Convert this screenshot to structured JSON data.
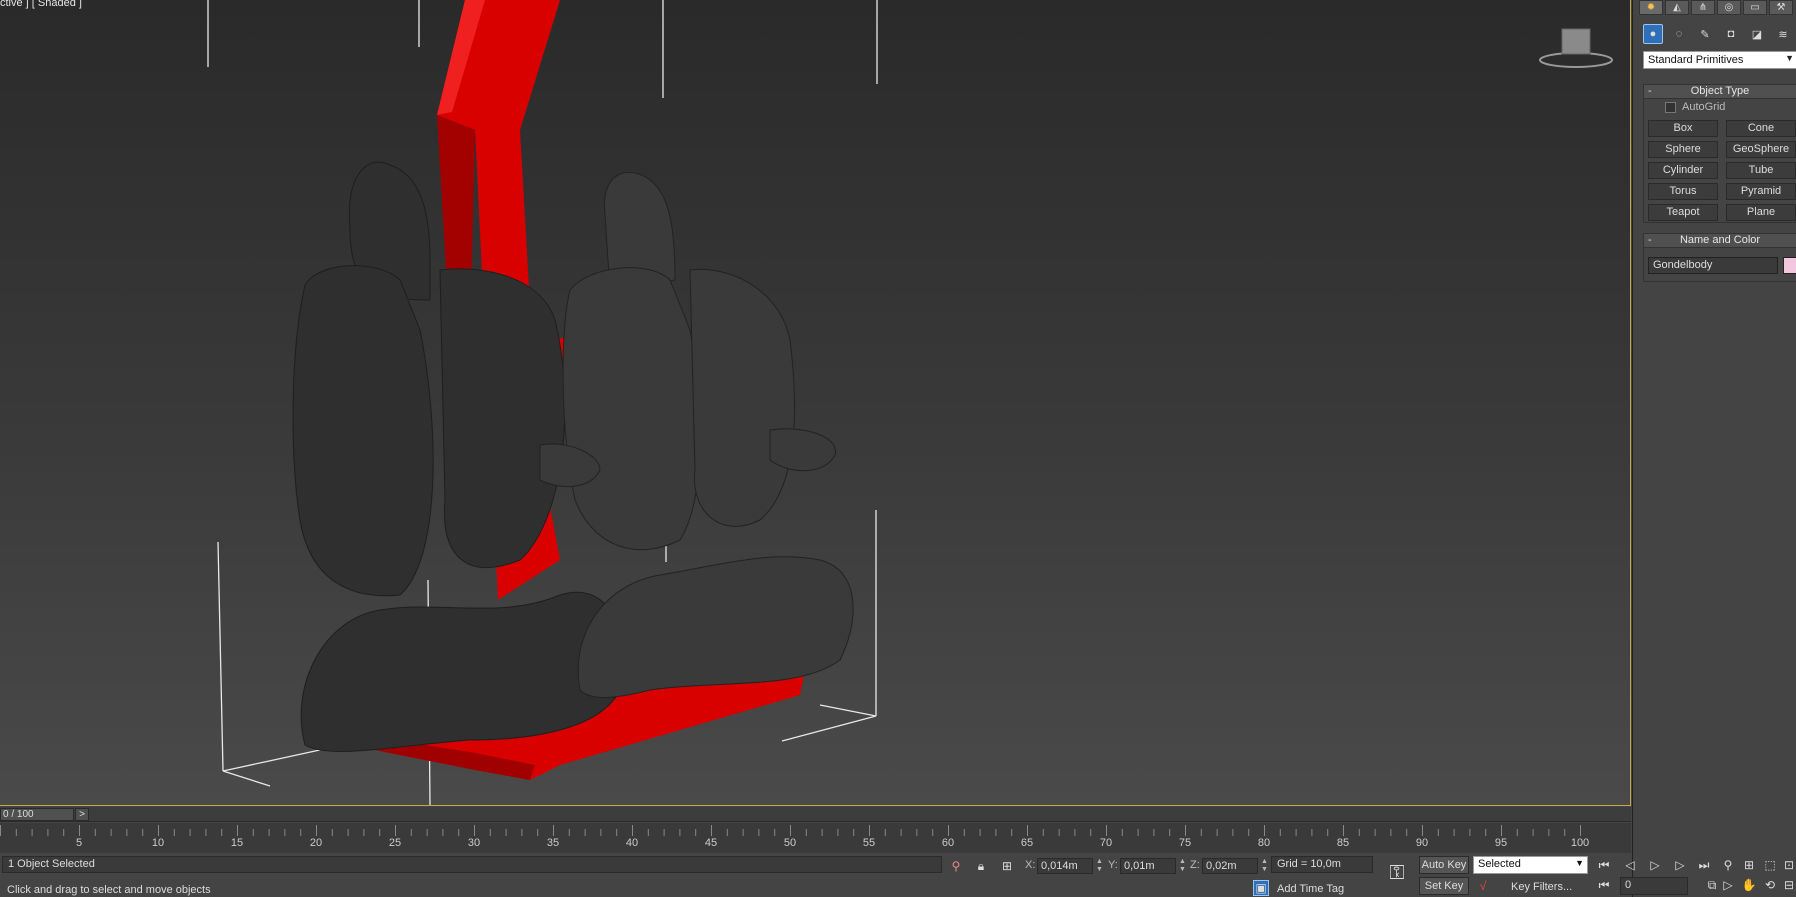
{
  "viewport": {
    "label": "ctive ] [ Shaded ]"
  },
  "command_panel": {
    "tabs": [
      "create-icon",
      "modify-icon",
      "hierarchy-icon",
      "motion-icon",
      "display-icon",
      "utilities-icon"
    ],
    "category_dropdown": "Standard Primitives",
    "object_type": {
      "title": "Object Type",
      "autogrid_label": "AutoGrid",
      "buttons": [
        "Box",
        "Cone",
        "Sphere",
        "GeoSphere",
        "Cylinder",
        "Tube",
        "Torus",
        "Pyramid",
        "Teapot",
        "Plane"
      ]
    },
    "name_and_color": {
      "title": "Name and Color",
      "name_value": "Gondelbody",
      "color": "#f3c7e0"
    },
    "rollout_collapse": "-"
  },
  "timeline": {
    "frame_display": "0 / 100",
    "next_label": ">",
    "ticks": [
      "5",
      "10",
      "15",
      "20",
      "25",
      "30",
      "35",
      "40",
      "45",
      "50",
      "55",
      "60",
      "65",
      "70",
      "75",
      "80",
      "85",
      "90",
      "95",
      "100"
    ]
  },
  "status": {
    "selection": "1 Object Selected",
    "prompt": "Click and drag to select and move objects",
    "x_label": "X:",
    "x_value": "0,014m",
    "y_label": "Y:",
    "y_value": "0,01m",
    "z_label": "Z:",
    "z_value": "0,02m",
    "grid": "Grid = 10,0m",
    "add_time_tag": "Add Time Tag"
  },
  "animation": {
    "auto_key": "Auto Key",
    "set_key": "Set Key",
    "selected_dropdown": "Selected",
    "key_filters": "Key Filters...",
    "current_frame": "0"
  },
  "colors": {
    "accent_border": "#c8a748",
    "model_red": "#d90000",
    "seat_dark": "#2e2e2e"
  }
}
